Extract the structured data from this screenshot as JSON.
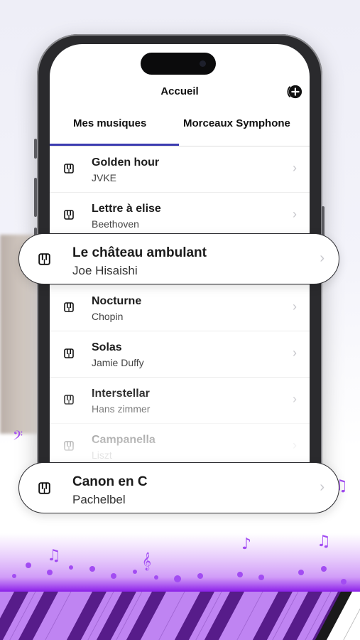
{
  "header": {
    "title": "Accueil",
    "add_icon": "add-circle-icon"
  },
  "tabs": [
    {
      "label": "Mes musiques",
      "selected": true
    },
    {
      "label": "Morceaux Symphone",
      "selected": false
    }
  ],
  "list": [
    {
      "title": "Golden hour",
      "artist": "JVKE"
    },
    {
      "title": "Lettre à elise",
      "artist": "Beethoven"
    },
    {
      "title": "Nocturne",
      "artist": "Chopin"
    },
    {
      "title": "Solas",
      "artist": "Jamie Duffy"
    },
    {
      "title": "Interstellar",
      "artist": "Hans zimmer"
    },
    {
      "title": "Campanella",
      "artist": "Liszt"
    }
  ],
  "highlight": [
    {
      "title": "Le château ambulant",
      "artist": "Joe Hisaishi"
    },
    {
      "title": "Canon en C",
      "artist": "Pachelbel"
    }
  ],
  "colors": {
    "accent": "#3b3bb0",
    "purple": "#9b3cf0"
  }
}
